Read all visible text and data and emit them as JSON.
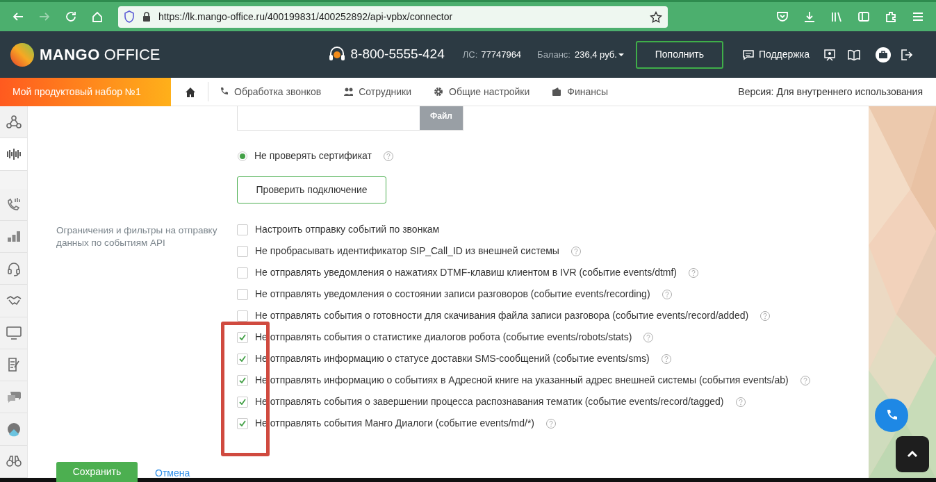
{
  "browser": {
    "url": "https://lk.mango-office.ru/400199831/400252892/api-vpbx/connector",
    "forward_disabled": true
  },
  "header": {
    "logo_brand": "MANGO",
    "logo_suffix": "OFFICE",
    "phone": "8-800-5555-424",
    "account_label": "ЛС:",
    "account_number": "77747964",
    "balance_label": "Баланс:",
    "balance_value": "236,4 руб.",
    "topup_button": "Пополнить",
    "support": "Поддержка"
  },
  "nav": {
    "product_set": "Мой продуктовый набор №1",
    "items": [
      {
        "label": "Обработка звонков"
      },
      {
        "label": "Сотрудники"
      },
      {
        "label": "Общие настройки"
      },
      {
        "label": "Финансы"
      }
    ],
    "version": "Версия: Для внутреннего использования"
  },
  "sidebar": {
    "items": [
      {
        "selected": false
      },
      {
        "selected": true
      },
      {
        "selected": false
      },
      {
        "selected": false
      },
      {
        "selected": false
      },
      {
        "selected": false
      },
      {
        "selected": false
      },
      {
        "selected": false
      },
      {
        "selected": false
      },
      {
        "selected": false
      },
      {
        "selected": false
      }
    ]
  },
  "form": {
    "file_button": "Файл",
    "radio": {
      "label": "Не проверять сертификат",
      "selected": true
    },
    "check_button": "Проверить подключение",
    "filters": {
      "label": "Ограничения и фильтры на отправку данных по событиям API",
      "options": [
        {
          "label": "Настроить отправку событий по звонкам",
          "checked": false,
          "help": false
        },
        {
          "label": "Не пробрасывать идентификатор SIP_Call_ID из внешней системы",
          "checked": false,
          "help": true
        },
        {
          "label": "Не отправлять уведомления о нажатиях DTMF-клавиш клиентом в IVR (событие events/dtmf)",
          "checked": false,
          "help": true
        },
        {
          "label": "Не отправлять уведомления о состоянии записи разговоров (событие events/recording)",
          "checked": false,
          "help": true
        },
        {
          "label": "Не отправлять события о готовности для скачивания файла записи разговора (событие events/record/added)",
          "checked": false,
          "help": true
        },
        {
          "label": "Не отправлять события о статистике диалогов робота (событие events/robots/stats)",
          "checked": true,
          "help": true
        },
        {
          "label": "Не отправлять информацию о статусе доставки SMS-сообщений (событие events/sms)",
          "checked": true,
          "help": true
        },
        {
          "label": "Не отправлять информацию о событиях в Адресной книге на указанный адрес внешней системы (события events/ab)",
          "checked": true,
          "help": true
        },
        {
          "label": "Не отправлять события о завершении процесса распознавания тематик (событие events/record/tagged)",
          "checked": true,
          "help": true
        },
        {
          "label": "Не отправлять события Манго Диалоги (событие events/md/*)",
          "checked": true,
          "help": true
        }
      ]
    },
    "save_button": "Сохранить",
    "cancel_link": "Отмена"
  }
}
